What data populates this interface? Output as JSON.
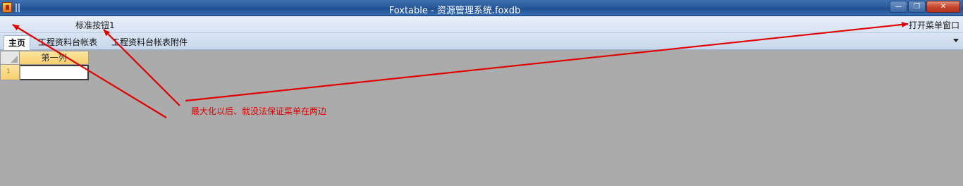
{
  "window": {
    "title": "Foxtable - 资源管理系统.foxdb",
    "minimize_label": "—",
    "maximize_label": "❐",
    "close_label": "✕"
  },
  "toolbar": {
    "standard_button_label": "标准按钮1",
    "open_menu_window_label": "打开菜单窗口"
  },
  "tabs": [
    {
      "label": "主页",
      "active": true
    },
    {
      "label": "工程资料台帐表",
      "active": false
    },
    {
      "label": "工程资料台帐表附件",
      "active": false
    }
  ],
  "grid": {
    "column_header": "第一列",
    "row_number": "1",
    "cell_value": ""
  },
  "annotation": {
    "text": "最大化以后、就没法保证菜单在两边",
    "color": "#e00000"
  },
  "colors": {
    "titlebar": "#2a5a9c",
    "workspace": "#ababab",
    "column_header": "#f7cf6d",
    "annotation_arrows": "#e00000"
  }
}
